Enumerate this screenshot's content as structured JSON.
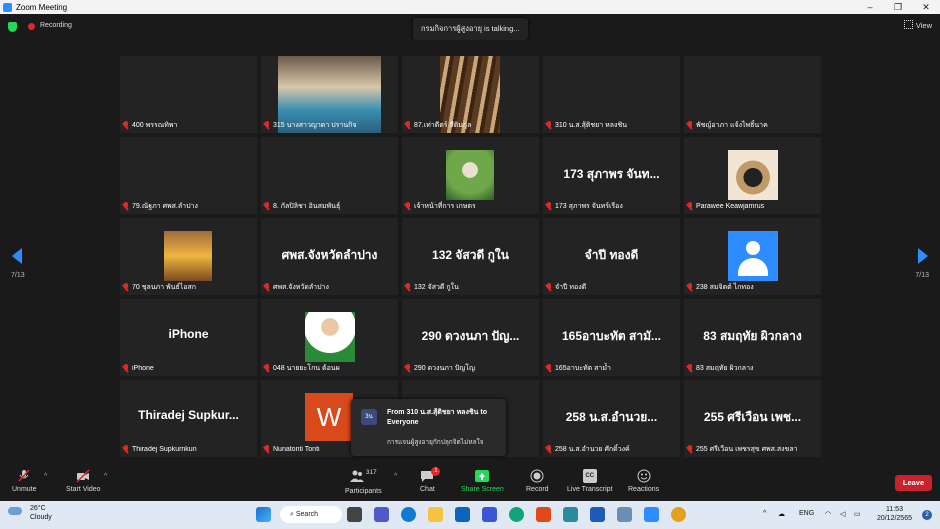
{
  "window": {
    "title": "Zoom Meeting",
    "controls": [
      "–",
      "❐",
      "✕"
    ]
  },
  "topbar": {
    "recording_label": "Recording",
    "talking": "กรมกิจการผู้สูงอายุ is talking...",
    "view_label": "View"
  },
  "pagination": {
    "left": "7/13",
    "right": "7/13"
  },
  "tiles": [
    {
      "name": "400 พรรณทิพา",
      "big": "",
      "video": ""
    },
    {
      "name": "315 นางสาวญาดา ปรานกิจ",
      "big": "",
      "video": "v1"
    },
    {
      "name": "87.เท่าดีตร์ สีติมกุล",
      "big": "",
      "video": "v2"
    },
    {
      "name": "310 น.ส.สุ้ติชยา หลงชิน",
      "big": "",
      "video": ""
    },
    {
      "name": "พัชญ์อาภา แจ้งไพธิ์นาค",
      "big": "",
      "video": ""
    },
    {
      "name": "79.ณัฐภา ศพส.ลำปาง",
      "big": "",
      "video": ""
    },
    {
      "name": "8. กัลปิลิชา อินสมพันธุ์",
      "big": "",
      "video": ""
    },
    {
      "name": "เจ้าหน้าที่การ เกษตร",
      "big": "",
      "video": "v3"
    },
    {
      "name": "173 สุภาพร จันทร์เรือง",
      "big": "173 สุภาพร จันท...",
      "video": ""
    },
    {
      "name": "Parawee Keawjamrus",
      "big": "",
      "video": "v4"
    },
    {
      "name": "70 ชุลนภา พันธ์ไอสก",
      "big": "",
      "video": "v5"
    },
    {
      "name": "ศพส.จังหวัดลำปาง",
      "big": "ศพส.จังหวัดลำปาง",
      "video": ""
    },
    {
      "name": "132 จัสวดี กูใน",
      "big": "132 จัสวดี กูใน",
      "video": ""
    },
    {
      "name": "จำปี ทองดี",
      "big": "จำปี ทองดี",
      "video": ""
    },
    {
      "name": "238 สมจิตต์ ไกทอง",
      "big": "",
      "video": "avatar"
    },
    {
      "name": "iPhone",
      "big": "iPhone",
      "video": ""
    },
    {
      "name": "048 นายยะโกน ต้อนผ",
      "big": "",
      "video": "v6"
    },
    {
      "name": "290 ดวงนภา ปัญโญ",
      "big": "290 ดวงนภา ปัญ...",
      "video": ""
    },
    {
      "name": "165อาบะทัต สามัำ",
      "big": "165อาบะทัต สามั...",
      "video": ""
    },
    {
      "name": "83 สมฤทัย ผิวกลาง",
      "big": "83 สมฤทัย ผิวกลาง",
      "video": ""
    },
    {
      "name": "Thiradej Supkurnkun",
      "big": "Thiradej Supkur...",
      "video": ""
    },
    {
      "name": "Nunatonti Tonti",
      "big": "",
      "video": "w"
    },
    {
      "name": "",
      "big": "",
      "video": ""
    },
    {
      "name": "258 น.ส.อำนวย ศักดิ์วงค์",
      "big": "258 น.ส.อำนวย...",
      "video": ""
    },
    {
      "name": "255 ศรีเวือน เพชรสุข ศพส.สงขลา",
      "big": "255 ศรีเวือน เพช...",
      "video": ""
    }
  ],
  "chat_popup": {
    "avatar": "3น",
    "from": "From 310 น.ส.สุ้ติชยา หลงชิน to Everyone",
    "message": "การแจนผู้สูงอายุกักปลุกจิตไม่หลใจ"
  },
  "toolbar": {
    "unmute": "Unmute",
    "start_video": "Start Video",
    "participants": "Participants",
    "participants_count": "317",
    "chat": "Chat",
    "chat_badge": "1",
    "share": "Share Screen",
    "record": "Record",
    "cc": "CC",
    "transcript": "Live Transcript",
    "reactions": "Reactions",
    "leave": "Leave"
  },
  "taskbar": {
    "temp": "26°C",
    "weather": "Cloudy",
    "search": "Search",
    "lang": "ENG",
    "time": "11:53",
    "date": "20/12/2565",
    "notif": "2"
  }
}
